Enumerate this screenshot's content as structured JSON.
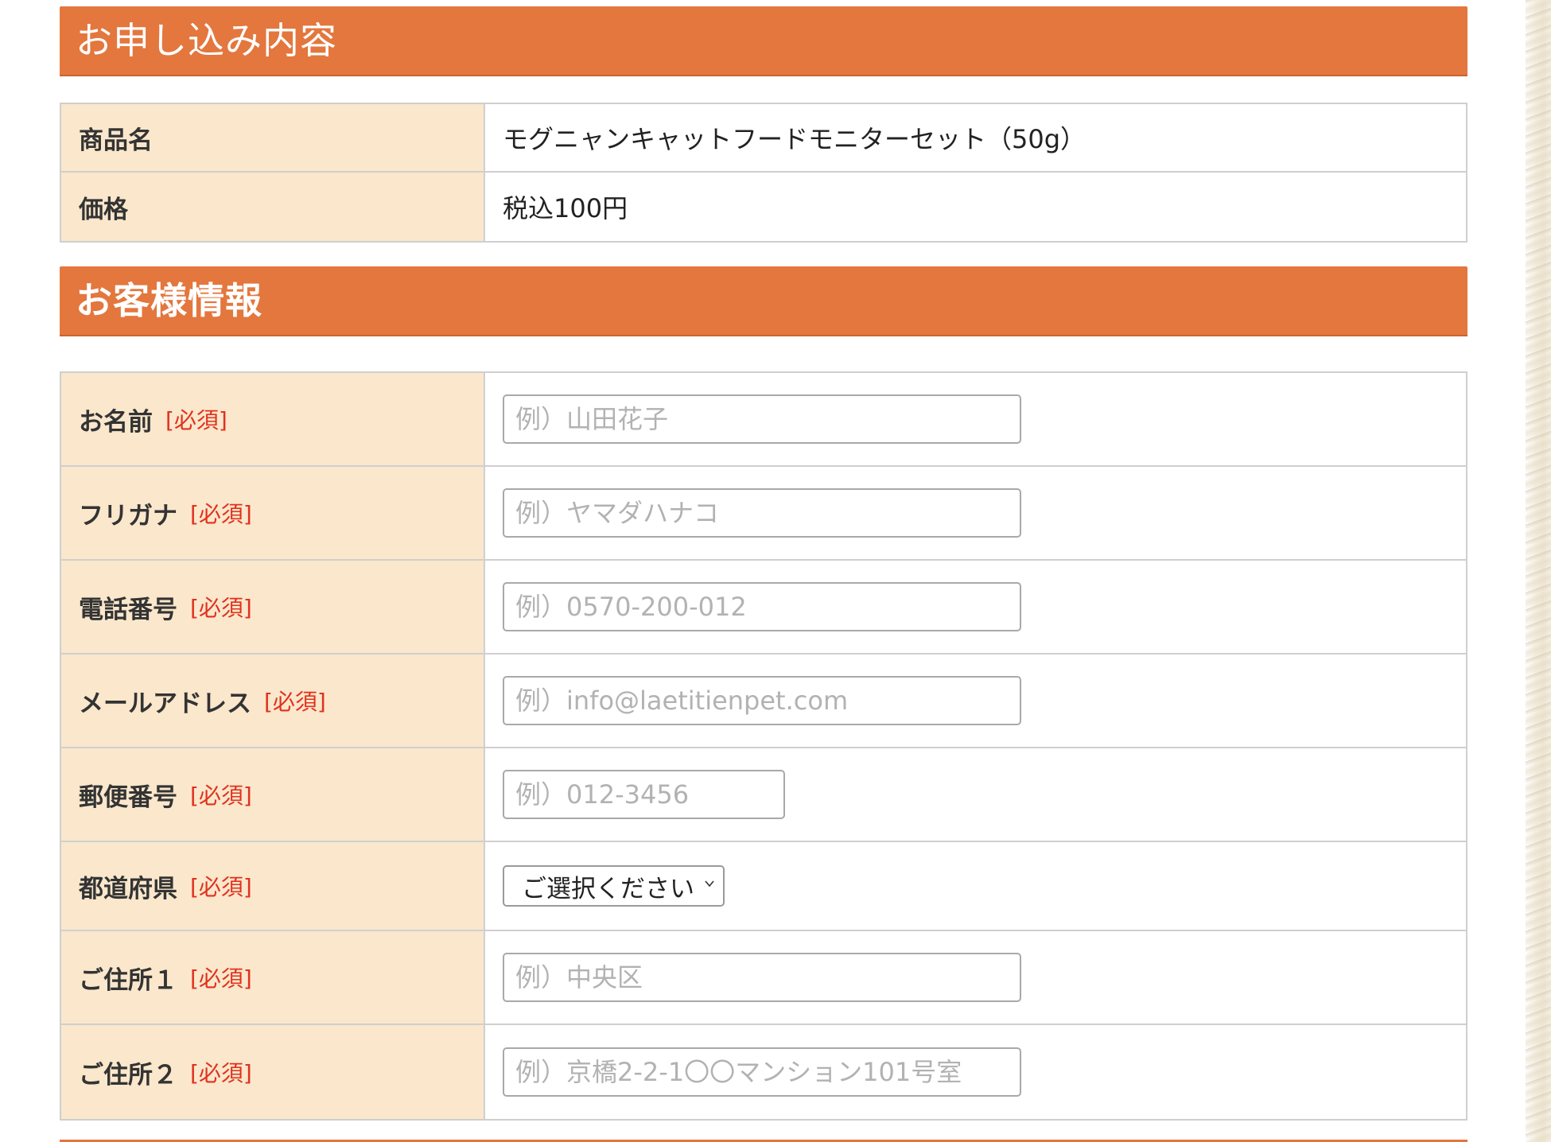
{
  "colors": {
    "header_bg": "#e3773e",
    "label_bg": "#fae7cc",
    "required_text": "#e0321e",
    "border": "#cfcfcf"
  },
  "order_section": {
    "title": "お申し込み内容",
    "rows": [
      {
        "label": "商品名",
        "value": "モグニャンキャットフードモニターセット（50g）"
      },
      {
        "label": "価格",
        "value": "税込100円"
      }
    ]
  },
  "customer_section": {
    "title": "お客様情報",
    "required_label": "[必須]",
    "fields": {
      "name": {
        "label": "お名前",
        "placeholder": "例）山田花子"
      },
      "furigana": {
        "label": "フリガナ",
        "placeholder": "例）ヤマダハナコ"
      },
      "phone": {
        "label": "電話番号",
        "placeholder": "例）0570-200-012"
      },
      "email": {
        "label": "メールアドレス",
        "placeholder": "例）info@laetitienpet.com"
      },
      "postal": {
        "label": "郵便番号",
        "placeholder": "例）012-3456"
      },
      "prefecture": {
        "label": "都道府県",
        "selected": "ご選択ください"
      },
      "address1": {
        "label": "ご住所１",
        "placeholder": "例）中央区"
      },
      "address2": {
        "label": "ご住所２",
        "placeholder": "例）京橋2-2-1〇〇マンション101号室"
      }
    }
  }
}
